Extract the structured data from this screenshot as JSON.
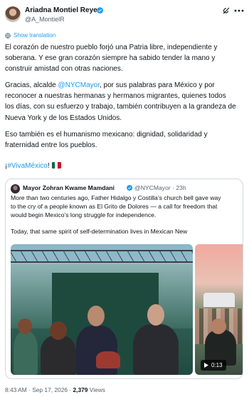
{
  "author": {
    "name": "Ariadna Montiel Reyes",
    "handle": "@A_MontielR",
    "verified_color": "#1d9bf0"
  },
  "actions": {
    "grok_icon": "grok-icon",
    "more_icon": "more-icon"
  },
  "translate": {
    "label": "Show translation",
    "icon": "globe-icon"
  },
  "post": {
    "p1": [
      "El corazón de nuestro pueblo forjó una Patria libre, independiente y",
      "soberana. Y ese gran corazón siempre ha sabido tender la mano y",
      "construir amistad con otras naciones."
    ],
    "p2_l1_prefix": "Gracias, alcalde ",
    "p2_mention": "@NYCMayor",
    "p2_l1_suffix": ", por sus palabras para México y por",
    "p2_rest": [
      "reconocer a nuestras hermanas y hermanos migrantes, quienes todos",
      "los días, con su esfuerzo y trabajo, también contribuyen a la grandeza de",
      "Nueva York y de los Estados Unidos."
    ],
    "p3": [
      "Eso también es el humanismo mexicano: dignidad, solidaridad y",
      "fraternidad entre los pueblos."
    ],
    "hashtag_prefix": "¡",
    "hashtag": "#VivaMéxico",
    "hashtag_suffix": "!",
    "flag_emoji": "mexico-flag-icon"
  },
  "quote": {
    "name": "Mayor Zohran Kwame Mamdani",
    "handle": "@NYCMayor",
    "dot": "·",
    "time": "23h",
    "text": [
      "More than two centuries ago, Father Hidalgo y Costilla’s church bell gave way",
      "to the cry of a people known as El Grito de Dolores — a call for freedom that",
      "would begin Mexico’s long struggle for independence.",
      "",
      "Today, that same spirit of self-determination lives in Mexican New"
    ],
    "video_duration": "0:13"
  },
  "meta": {
    "time": "8:43 AM",
    "sep": " · ",
    "date": "Sep 17, 2026",
    "sep2": " · ",
    "views_count": "2,379",
    "views_label": " Views"
  },
  "colors": {
    "accent": "#1d9bf0",
    "text": "#0f1419",
    "muted": "#536471",
    "border": "#cfd9de"
  }
}
